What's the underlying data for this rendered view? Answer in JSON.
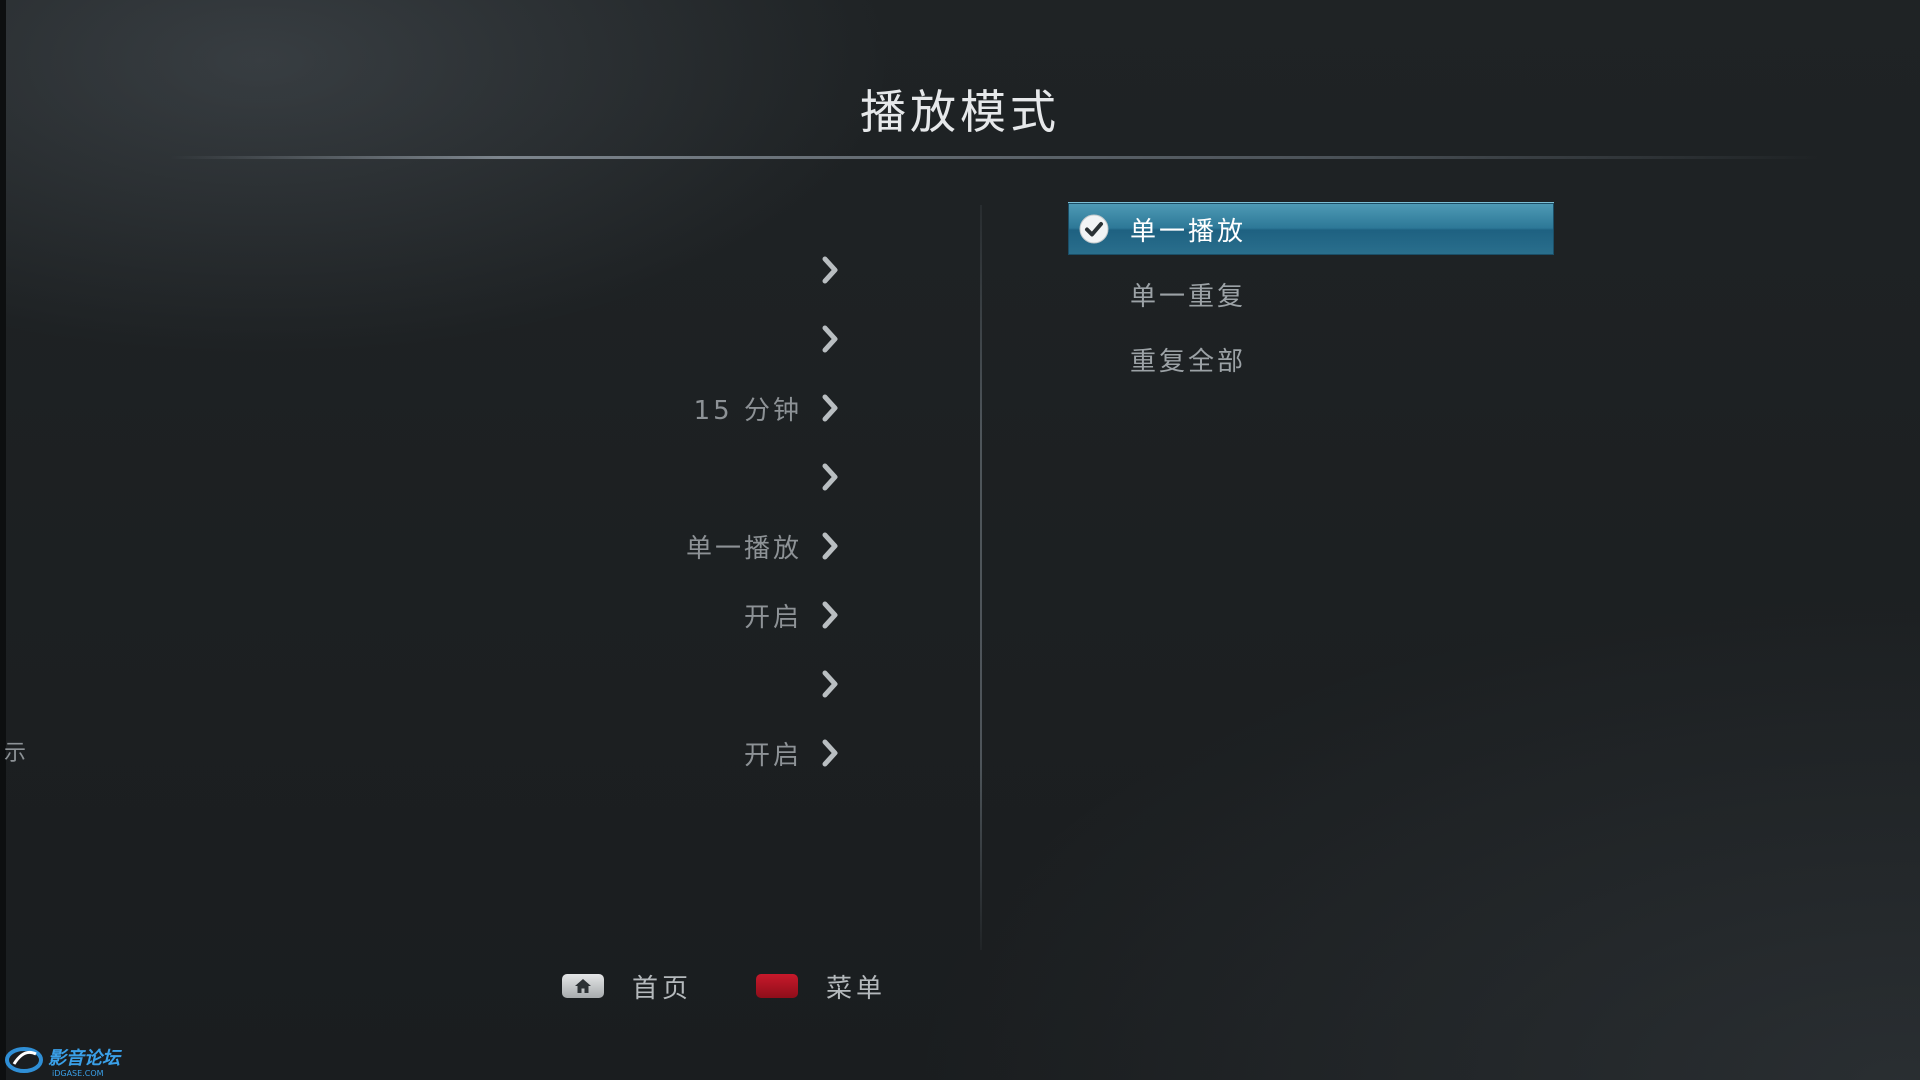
{
  "title": "播放模式",
  "left_menu": {
    "items": [
      {
        "value": ""
      },
      {
        "value": ""
      },
      {
        "value": "15 分钟"
      },
      {
        "value": ""
      },
      {
        "value": "单一播放"
      },
      {
        "value": "开启"
      },
      {
        "value": ""
      },
      {
        "value": "开启"
      }
    ],
    "stray_text": "示"
  },
  "options": {
    "items": [
      {
        "label": "单一播放",
        "selected": true
      },
      {
        "label": "单一重复",
        "selected": false
      },
      {
        "label": "重复全部",
        "selected": false
      }
    ]
  },
  "footer": {
    "home_label": "首页",
    "menu_label": "菜单"
  },
  "watermark": {
    "text": "影音论坛",
    "subtext": "iDGASE.COM"
  },
  "colors": {
    "accent": "#2d7897",
    "menu_key": "#c8192b"
  },
  "icons": {
    "chevron": "chevron-right-icon",
    "check": "check-circle-icon",
    "home": "home-icon"
  }
}
